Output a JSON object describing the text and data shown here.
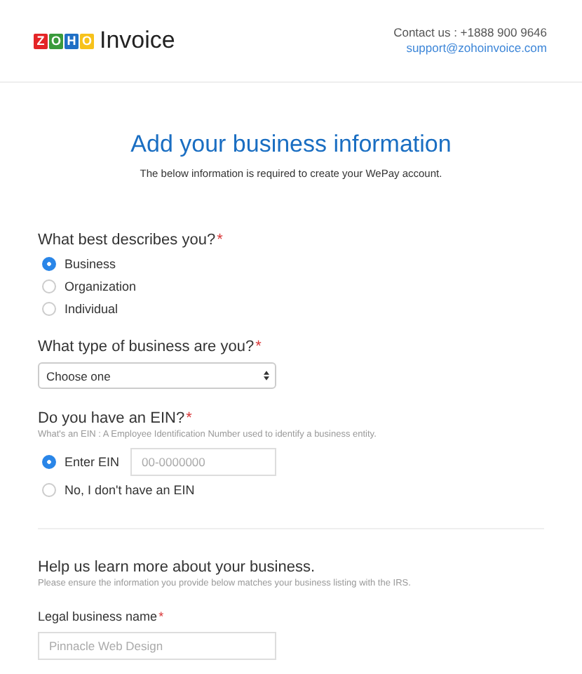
{
  "header": {
    "logo_letters": [
      {
        "text": "Z",
        "color": "#e42527"
      },
      {
        "text": "O",
        "color": "#3a9b3c"
      },
      {
        "text": "H",
        "color": "#1f6fc5"
      },
      {
        "text": "O",
        "color": "#f7c21b"
      }
    ],
    "product": "Invoice",
    "contact": "Contact us : +1888 900 9646",
    "email": "support@zohoinvoice.com"
  },
  "title": "Add your business information",
  "subtitle": "The below information is required to create your WePay account.",
  "describe": {
    "label": "What best describes you?",
    "mark": "*",
    "options": [
      {
        "label": "Business",
        "selected": true
      },
      {
        "label": "Organization",
        "selected": false
      },
      {
        "label": "Individual",
        "selected": false
      }
    ]
  },
  "business_type": {
    "label": "What type of business are you?",
    "mark": "*",
    "value": "Choose one"
  },
  "ein": {
    "label": "Do you have an EIN?",
    "mark": "*",
    "hint": "What's an EIN : A Employee Identification Number used to identify a business entity.",
    "options": [
      {
        "label": "Enter EIN",
        "selected": true,
        "placeholder": "00-0000000"
      },
      {
        "label": "No, I don't have an EIN",
        "selected": false
      }
    ]
  },
  "more": {
    "heading": "Help us learn more about your business.",
    "hint": "Please ensure the information you provide below matches your business listing with the IRS.",
    "legal_name": {
      "label": "Legal business name",
      "mark": "*",
      "placeholder": "Pinnacle Web Design"
    }
  }
}
